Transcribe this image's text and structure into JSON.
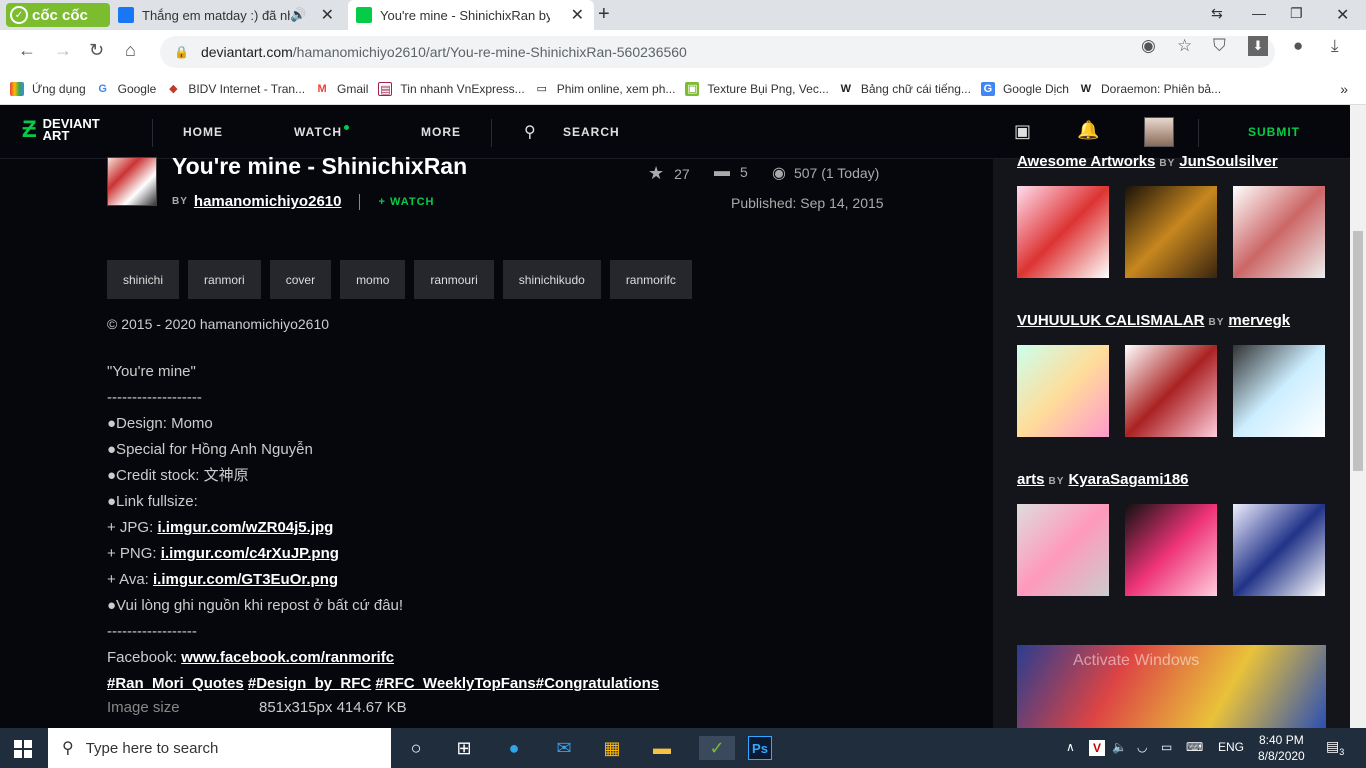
{
  "browser": {
    "logo": "cốc cốc",
    "tabs": [
      {
        "title": "Thắng em matday :) đã nh",
        "favicon_color": "#1877f2"
      },
      {
        "title": "You're mine - ShinichixRan by",
        "favicon_color": "#05cc47"
      }
    ],
    "url_domain": "deviantart.com",
    "url_path": "/hamanomichiyo2610/art/You-re-mine-ShinichixRan-560236560",
    "bookmarks": [
      {
        "label": "Ứng dụng",
        "icon": "apps-grid-icon"
      },
      {
        "label": "Google",
        "icon": "google-icon"
      },
      {
        "label": "BIDV Internet - Tran...",
        "icon": "bidv-icon"
      },
      {
        "label": "Gmail",
        "icon": "gmail-icon"
      },
      {
        "label": "Tin nhanh VnExpress...",
        "icon": "vnexpress-icon"
      },
      {
        "label": "Phim online, xem ph...",
        "icon": "tv-icon"
      },
      {
        "label": "Texture Bụi Png, Vec...",
        "icon": "image-icon"
      },
      {
        "label": "Bảng chữ cái tiếng...",
        "icon": "wikipedia-icon"
      },
      {
        "label": "Google Dịch",
        "icon": "translate-icon"
      },
      {
        "label": "Doraemon: Phiên bả...",
        "icon": "wikipedia-icon"
      }
    ]
  },
  "header": {
    "logo_line1": "DEVIANT",
    "logo_line2": "ART",
    "nav": [
      "HOME",
      "WATCH",
      "MORE",
      "SEARCH"
    ],
    "submit": "SUBMIT"
  },
  "deviation": {
    "title": "You're mine - ShinichixRan",
    "by": "BY",
    "author": "hamanomichiyo2610",
    "watch": "+ WATCH",
    "favourites": "27",
    "comments": "5",
    "views": "507 (1 Today)",
    "published": "Published: Sep 14, 2015",
    "tags": [
      "shinichi",
      "ranmori",
      "cover",
      "momo",
      "ranmouri",
      "shinichikudo",
      "ranmorifc"
    ],
    "copyright": "© 2015 - 2020 hamanomichiyo2610",
    "description": {
      "l1": "\"You're mine\"",
      "l2": "-------------------",
      "l3": "●Design: Momo",
      "l4": "●Special for Hồng Anh Nguyễn",
      "l5": "●Credit stock: 文神原",
      "l6": "●Link fullsize:",
      "l7_prefix": "+ JPG: ",
      "l7_link": "i.imgur.com/wZR04j5.jpg",
      "l8_prefix": "+ PNG: ",
      "l8_link": "i.imgur.com/c4rXuJP.png",
      "l9_prefix": "+ Ava: ",
      "l9_link": "i.imgur.com/GT3EuOr.png",
      "l10": "●Vui lòng ghi nguồn khi repost ở bất cứ đâu!",
      "l11": "------------------",
      "l12_prefix": "Facebook: ",
      "l12_link": "www.facebook.com/ranmorifc",
      "hashtags": [
        "#Ran_Mori_Quotes",
        "#Design_by_RFC",
        "#RFC_WeeklyTopFans",
        "#Congratulations"
      ]
    },
    "image_size_label": "Image size",
    "image_size_value": "851x315px 414.67 KB"
  },
  "sidebar": {
    "collections": [
      {
        "title": "Awesome Artworks",
        "by": "BY",
        "author": "JunSoulsilver"
      },
      {
        "title": "VUHUULUK CALISMALAR",
        "by": "BY",
        "author": "mervegk"
      },
      {
        "title": "arts",
        "by": "BY",
        "author": "KyaraSagami186"
      }
    ],
    "watermark": "Activate Windows"
  },
  "taskbar": {
    "search_placeholder": "Type here to search",
    "lang": "ENG",
    "time": "8:40 PM",
    "date": "8/8/2020",
    "notifications": "3"
  }
}
